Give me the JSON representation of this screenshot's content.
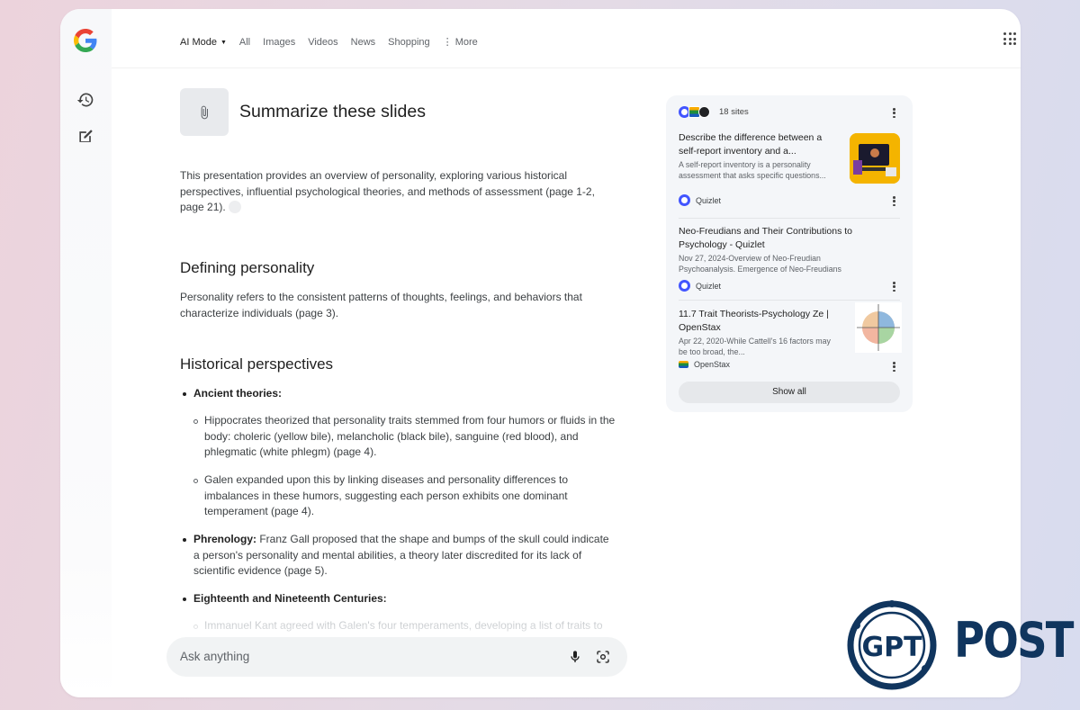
{
  "nav": {
    "mode": "AI Mode",
    "tabs": [
      "All",
      "Images",
      "Videos",
      "News",
      "Shopping"
    ],
    "more": "More"
  },
  "prompt": "Summarize these slides",
  "answer": {
    "intro": "This presentation provides an overview of personality, exploring various historical perspectives, influential psychological theories, and methods of assessment (page 1-2, page 21).",
    "section1_heading": "Defining personality",
    "section1_body": "Personality refers to the consistent patterns of thoughts, feelings, and behaviors that characterize individuals (page 3).",
    "section2_heading": "Historical perspectives",
    "ancient_label": "Ancient theories:",
    "hippocrates": "Hippocrates theorized that personality traits stemmed from four humors or fluids in the body: choleric (yellow bile), melancholic (black bile), sanguine (red blood), and phlegmatic (white phlegm) (page 4).",
    "galen": "Galen expanded upon this by linking diseases and personality differences to imbalances in these humors, suggesting each person exhibits one dominant temperament (page 4).",
    "phrenology_label": "Phrenology:",
    "phrenology_text": " Franz Gall proposed that the shape and bumps of the skull could indicate a person's personality and mental abilities, a theory later discredited for its lack of scientific evidence (page 5).",
    "centuries_label": "Eighteenth and Nineteenth Centuries:",
    "kant": "Immanuel Kant agreed with Galen's four temperaments, developing a list of traits to"
  },
  "ask": {
    "placeholder": "Ask anything"
  },
  "sources": {
    "count": "18 sites",
    "items": [
      {
        "title": "Describe the difference between a self-report inventory and a...",
        "snippet": "A self-report inventory is a personality assessment that asks specific questions...",
        "site": "Quizlet"
      },
      {
        "title": "Neo-Freudians and Their Contributions to Psychology - Quizlet",
        "snippet": "Nov 27, 2024-Overview of Neo-Freudian Psychoanalysis. Emergence of Neo-Freudians",
        "site": "Quizlet"
      },
      {
        "title": "11.7 Trait Theorists-Psychology Ze | OpenStax",
        "snippet": "Apr 22, 2020-While Cattell's 16 factors may be too broad, the...",
        "site": "OpenStax"
      }
    ],
    "show_all": "Show all"
  },
  "watermark": {
    "text": "POST",
    "mark": "GPT"
  },
  "colors": {
    "brand_blue": "#10355e",
    "quizlet": "#4255ff",
    "accent": "#1a73e8"
  }
}
